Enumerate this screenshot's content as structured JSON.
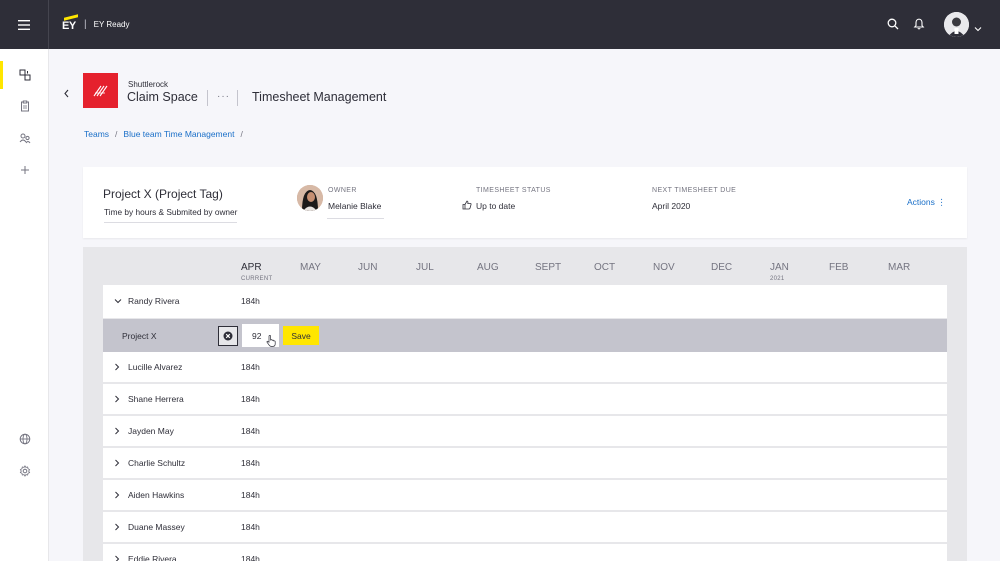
{
  "topbar": {
    "logo_text": "EY",
    "brand_separator": "|",
    "product_name": "EY Ready",
    "icons": [
      "menu-icon",
      "search-icon",
      "bell-icon",
      "user-avatar",
      "chevron-down-icon"
    ]
  },
  "sidebar": {
    "items": [
      {
        "icon": "workspace-icon",
        "active": true
      },
      {
        "icon": "clipboard-icon",
        "active": false
      },
      {
        "icon": "people-icon",
        "active": false
      },
      {
        "icon": "plus-icon",
        "active": false
      },
      {
        "icon": "globe-icon",
        "active": false
      },
      {
        "icon": "gear-icon",
        "active": false
      }
    ]
  },
  "header": {
    "org": "Shuttlerock",
    "app_title": "Claim Space",
    "more": "···",
    "page_title": "Timesheet Management"
  },
  "breadcrumb": {
    "items": [
      "Teams",
      "Blue team Time Management"
    ],
    "separator": "/"
  },
  "project": {
    "title": "Project X (Project Tag)",
    "subtitle": "Time by hours & Submited by owner",
    "owner_label": "OWNER",
    "owner_name": "Melanie Blake",
    "status_label": "TIMESHEET STATUS",
    "status_value": "Up to date",
    "due_label": "NEXT TIMESHEET DUE",
    "due_value": "April 2020",
    "actions_label": "Actions ⋮"
  },
  "timeline": {
    "months": [
      "APR",
      "MAY",
      "JUN",
      "JUL",
      "AUG",
      "SEPT",
      "OCT",
      "NOV",
      "DEC",
      "JAN",
      "FEB",
      "MAR"
    ],
    "current_label": "CURRENT",
    "year_label": "2021"
  },
  "rows": [
    {
      "name": "Randy Rivera",
      "hours": "184h",
      "expanded": true
    },
    {
      "name": "Lucille Alvarez",
      "hours": "184h"
    },
    {
      "name": "Shane Herrera",
      "hours": "184h"
    },
    {
      "name": "Jayden May",
      "hours": "184h"
    },
    {
      "name": "Charlie Schultz",
      "hours": "184h"
    },
    {
      "name": "Aiden Hawkins",
      "hours": "184h"
    },
    {
      "name": "Duane Massey",
      "hours": "184h"
    },
    {
      "name": "Eddie Rivera",
      "hours": "184h"
    }
  ],
  "edit_row": {
    "project": "Project X",
    "value": "92",
    "save_label": "Save"
  },
  "colors": {
    "topbar": "#2e2e38",
    "accent_yellow": "#ffe600",
    "link_blue": "#1a6fc8",
    "app_tile_red": "#e5212d",
    "panel_grey": "#e7e7ea"
  }
}
